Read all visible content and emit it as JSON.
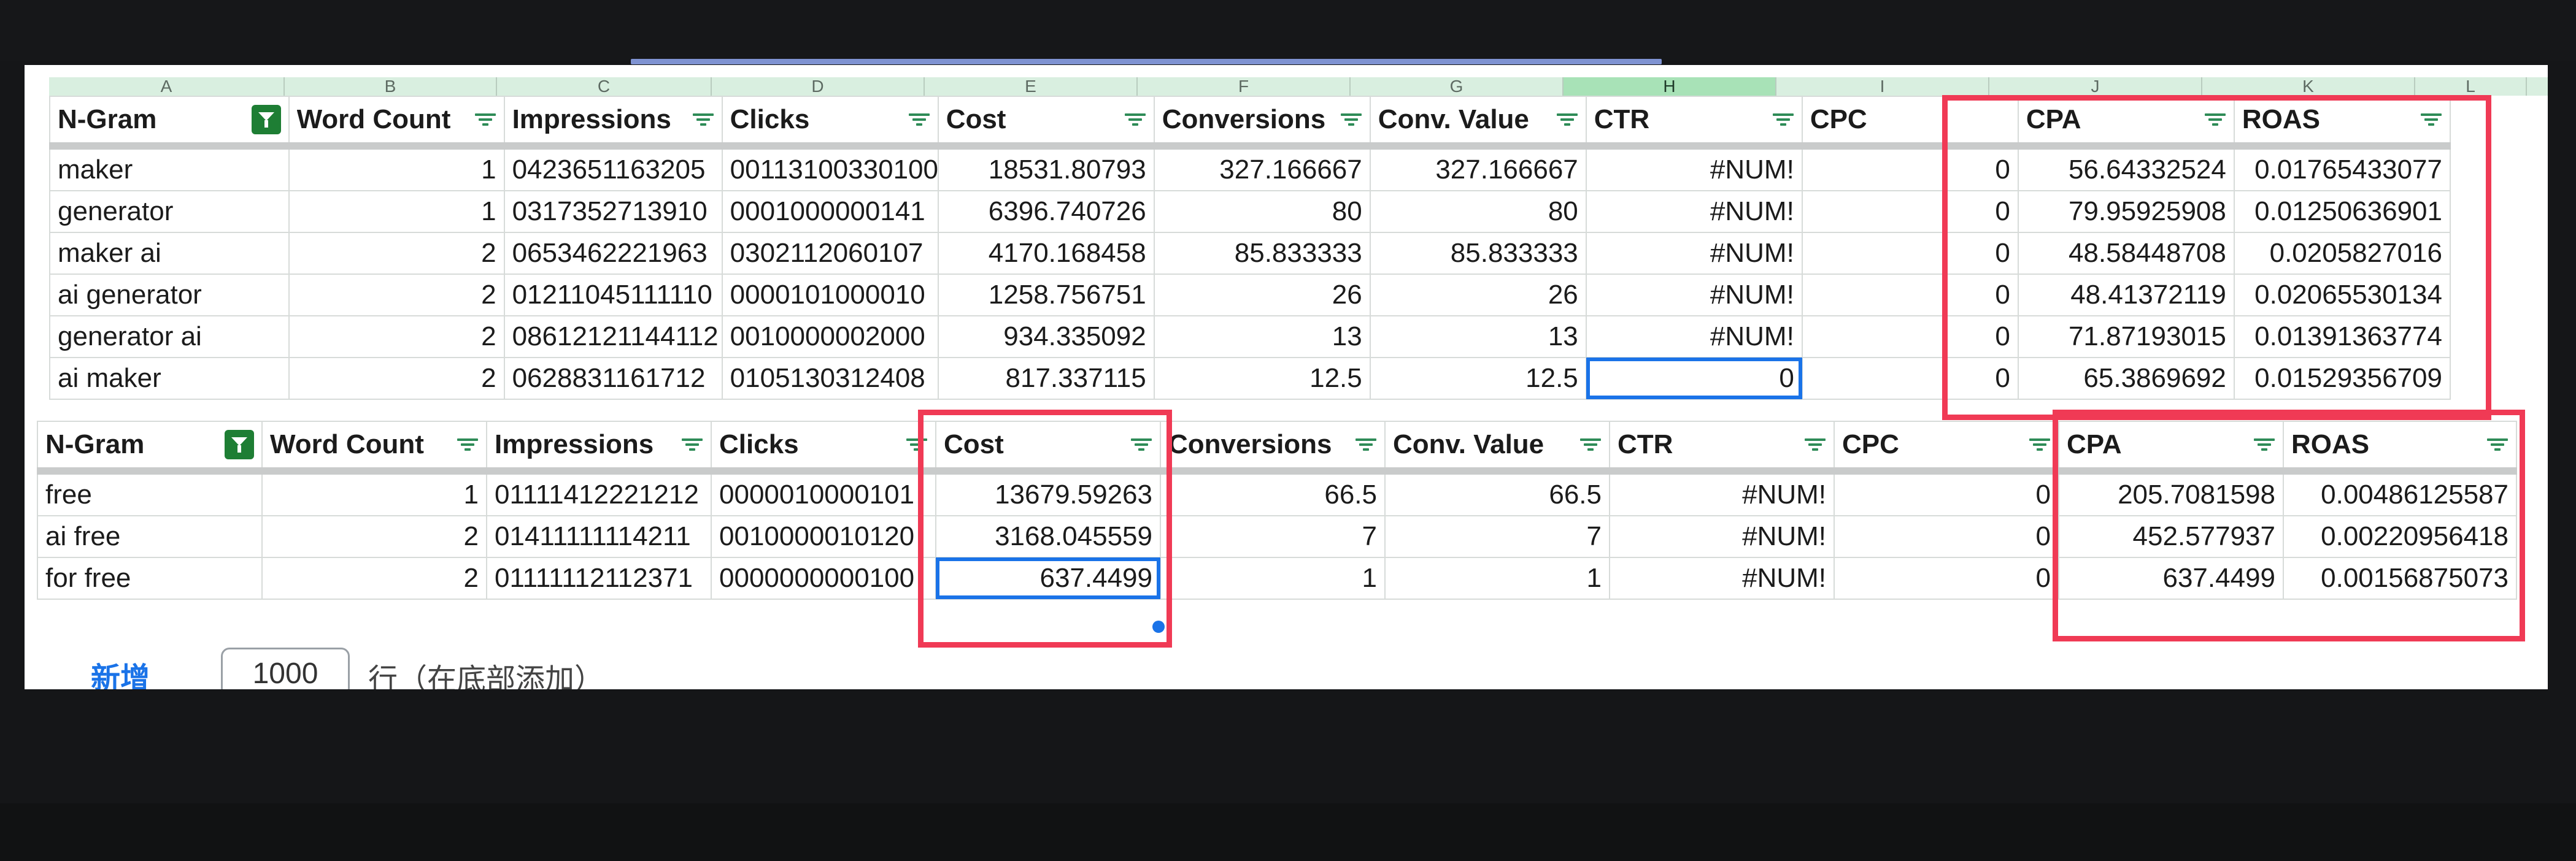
{
  "column_letters": [
    "A",
    "B",
    "C",
    "D",
    "E",
    "F",
    "G",
    "H",
    "I",
    "J",
    "K",
    "L"
  ],
  "table_top": {
    "headers": [
      "N-Gram",
      "Word Count",
      "Impressions",
      "Clicks",
      "Cost",
      "Conversions",
      "Conv. Value",
      "CTR",
      "CPC",
      "CPA",
      "ROAS"
    ],
    "rows": [
      [
        "maker",
        "1",
        "0423651163205",
        "00113100330100",
        "18531.80793",
        "327.166667",
        "327.166667",
        "#NUM!",
        "0",
        "56.64332524",
        "0.01765433077"
      ],
      [
        "generator",
        "1",
        "0317352713910",
        "0001000000141",
        "6396.740726",
        "80",
        "80",
        "#NUM!",
        "0",
        "79.95925908",
        "0.01250636901"
      ],
      [
        "maker ai",
        "2",
        "0653462221963",
        "0302112060107",
        "4170.168458",
        "85.833333",
        "85.833333",
        "#NUM!",
        "0",
        "48.58448708",
        "0.0205827016"
      ],
      [
        "ai generator",
        "2",
        "01211045111110",
        "0000101000010",
        "1258.756751",
        "26",
        "26",
        "#NUM!",
        "0",
        "48.41372119",
        "0.02065530134"
      ],
      [
        "generator ai",
        "2",
        "08612121144112",
        "0010000002000",
        "934.335092",
        "13",
        "13",
        "#NUM!",
        "0",
        "71.87193015",
        "0.01391363774"
      ],
      [
        "ai maker",
        "2",
        "0628831161712",
        "0105130312408",
        "817.337115",
        "12.5",
        "12.5",
        "0",
        "0",
        "65.3869692",
        "0.01529356709"
      ]
    ]
  },
  "table_bottom": {
    "headers": [
      "N-Gram",
      "Word Count",
      "Impressions",
      "Clicks",
      "Cost",
      "Conversions",
      "Conv. Value",
      "CTR",
      "CPC",
      "CPA",
      "ROAS"
    ],
    "rows": [
      [
        "free",
        "1",
        "01111412221212",
        "0000010000101",
        "13679.59263",
        "66.5",
        "66.5",
        "#NUM!",
        "0",
        "205.7081598",
        "0.00486125587"
      ],
      [
        "ai free",
        "2",
        "01411111114211",
        "0010000010120",
        "3168.045559",
        "7",
        "7",
        "#NUM!",
        "0",
        "452.577937",
        "0.00220956418"
      ],
      [
        "for free",
        "2",
        "01111112112371",
        "0000000000100",
        "637.4499",
        "1",
        "1",
        "#NUM!",
        "0",
        "637.4499",
        "0.00156875073"
      ]
    ]
  },
  "footer": {
    "add_label": "新增",
    "rows_value": "1000",
    "rows_suffix": "行（在底部添加）"
  },
  "colors": {
    "highlight": "#f03a55",
    "selection": "#1a73e8",
    "filter_active": "#1e7e34"
  }
}
